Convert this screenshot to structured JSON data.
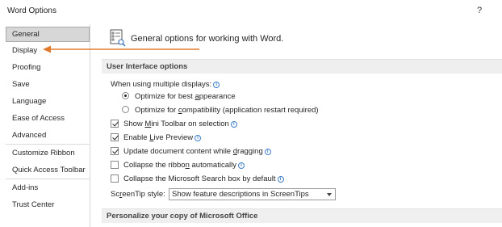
{
  "window": {
    "title": "Word Options",
    "help_label": "?"
  },
  "sidebar": {
    "items": [
      {
        "label": "General",
        "selected": true
      },
      {
        "label": "Display"
      },
      {
        "label": "Proofing"
      },
      {
        "label": "Save"
      },
      {
        "label": "Language"
      },
      {
        "label": "Ease of Access"
      },
      {
        "label": "Advanced"
      },
      {
        "label": "Customize Ribbon"
      },
      {
        "label": "Quick Access Toolbar"
      },
      {
        "label": "Add-ins"
      },
      {
        "label": "Trust Center"
      }
    ]
  },
  "main": {
    "header": {
      "icon": "general-options-icon",
      "text": "General options for working with Word."
    },
    "ui_section": {
      "title": "User Interface options",
      "multiple_displays_label": "When using multiple displays:",
      "radio_best": {
        "prefix": "Optimize for best ",
        "underlined": "a",
        "suffix": "ppearance",
        "selected": true
      },
      "radio_compat": {
        "prefix": "Optimize for ",
        "underlined": "c",
        "suffix": "ompatibility (application restart required)",
        "selected": false
      },
      "options": [
        {
          "prefix": "Show ",
          "underlined": "M",
          "suffix": "ini Toolbar on selection",
          "checked": true
        },
        {
          "prefix": "Enable ",
          "underlined": "L",
          "suffix": "ive Preview",
          "checked": true
        },
        {
          "prefix": "Update document content while ",
          "underlined": "d",
          "suffix": "ragging",
          "checked": true
        },
        {
          "prefix": "Collapse the ribbo",
          "underlined": "n",
          "suffix": " automatically",
          "checked": false
        },
        {
          "prefix": "Collapse the Microsoft Search box by default",
          "underlined": "",
          "suffix": "",
          "checked": false
        }
      ],
      "screentip": {
        "prefix": "Sc",
        "underlined": "r",
        "suffix": "eenTip style:",
        "value": "Show feature descriptions in ScreenTips"
      }
    },
    "personalize_section": {
      "title": "Personalize your copy of Microsoft Office"
    }
  },
  "colors": {
    "annotation_arrow": "#e07b2e",
    "info_icon": "#3c7ec9"
  }
}
